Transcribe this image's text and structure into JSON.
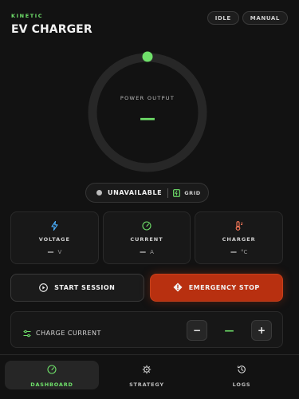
{
  "header": {
    "brand": "KINETIC",
    "title": "EV CHARGER",
    "pills": [
      "IDLE",
      "MANUAL"
    ]
  },
  "gauge": {
    "label": "POWER OUTPUT",
    "value": "—"
  },
  "status": {
    "state": "UNAVAILABLE",
    "source": "GRID"
  },
  "metrics": [
    {
      "icon": "lightning-icon",
      "label": "VOLTAGE",
      "value": "—",
      "unit": "V"
    },
    {
      "icon": "gauge-icon",
      "label": "CURRENT",
      "value": "—",
      "unit": "A"
    },
    {
      "icon": "thermometer-icon",
      "label": "CHARGER",
      "value": "—",
      "unit": "°C"
    }
  ],
  "actions": {
    "start": "START SESSION",
    "stop": "EMERGENCY STOP"
  },
  "charge": {
    "label": "CHARGE CURRENT",
    "value": "—",
    "minus": "−",
    "plus": "+"
  },
  "tabs": [
    {
      "icon": "dashboard-icon",
      "label": "DASHBOARD",
      "active": true
    },
    {
      "icon": "strategy-icon",
      "label": "STRATEGY",
      "active": false
    },
    {
      "icon": "history-icon",
      "label": "LOGS",
      "active": false
    }
  ],
  "colors": {
    "accent": "#6fe06a",
    "danger": "#b83010",
    "background": "#121212"
  }
}
